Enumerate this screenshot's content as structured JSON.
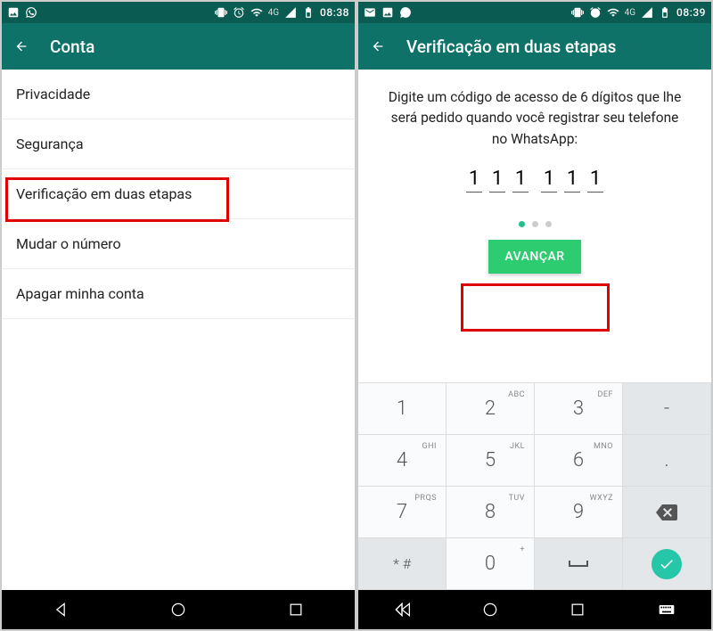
{
  "leftScreen": {
    "status": {
      "time": "08:38",
      "network": "4G"
    },
    "appbar": {
      "title": "Conta"
    },
    "menu": {
      "privacy": "Privacidade",
      "security": "Segurança",
      "twoStep": "Verificação em duas etapas",
      "changeNumber": "Mudar o número",
      "deleteAccount": "Apagar minha conta"
    }
  },
  "rightScreen": {
    "status": {
      "time": "08:39",
      "network": "4G"
    },
    "appbar": {
      "title": "Verificação em duas etapas"
    },
    "instructions": "Digite um código de acesso de 6 dígitos que lhe será pedido quando você registrar seu telefone no WhatsApp:",
    "pin": [
      "1",
      "1",
      "1",
      "1",
      "1",
      "1"
    ],
    "advanceLabel": "AVANÇAR",
    "keypad": {
      "k1": {
        "num": "1",
        "letters": ""
      },
      "k2": {
        "num": "2",
        "letters": "ABC"
      },
      "k3": {
        "num": "3",
        "letters": "DEF"
      },
      "kDash": {
        "num": "-",
        "letters": ""
      },
      "k4": {
        "num": "4",
        "letters": "GHI"
      },
      "k5": {
        "num": "5",
        "letters": "JKL"
      },
      "k6": {
        "num": "6",
        "letters": "MNO"
      },
      "kDot": {
        "num": ".",
        "letters": ""
      },
      "k7": {
        "num": "7",
        "letters": "PRQS"
      },
      "k8": {
        "num": "8",
        "letters": "TUV"
      },
      "k9": {
        "num": "9",
        "letters": "WXYZ"
      },
      "k0": {
        "num": "0",
        "letters": "+"
      },
      "kStar": {
        "num": "* #",
        "letters": ""
      }
    }
  }
}
